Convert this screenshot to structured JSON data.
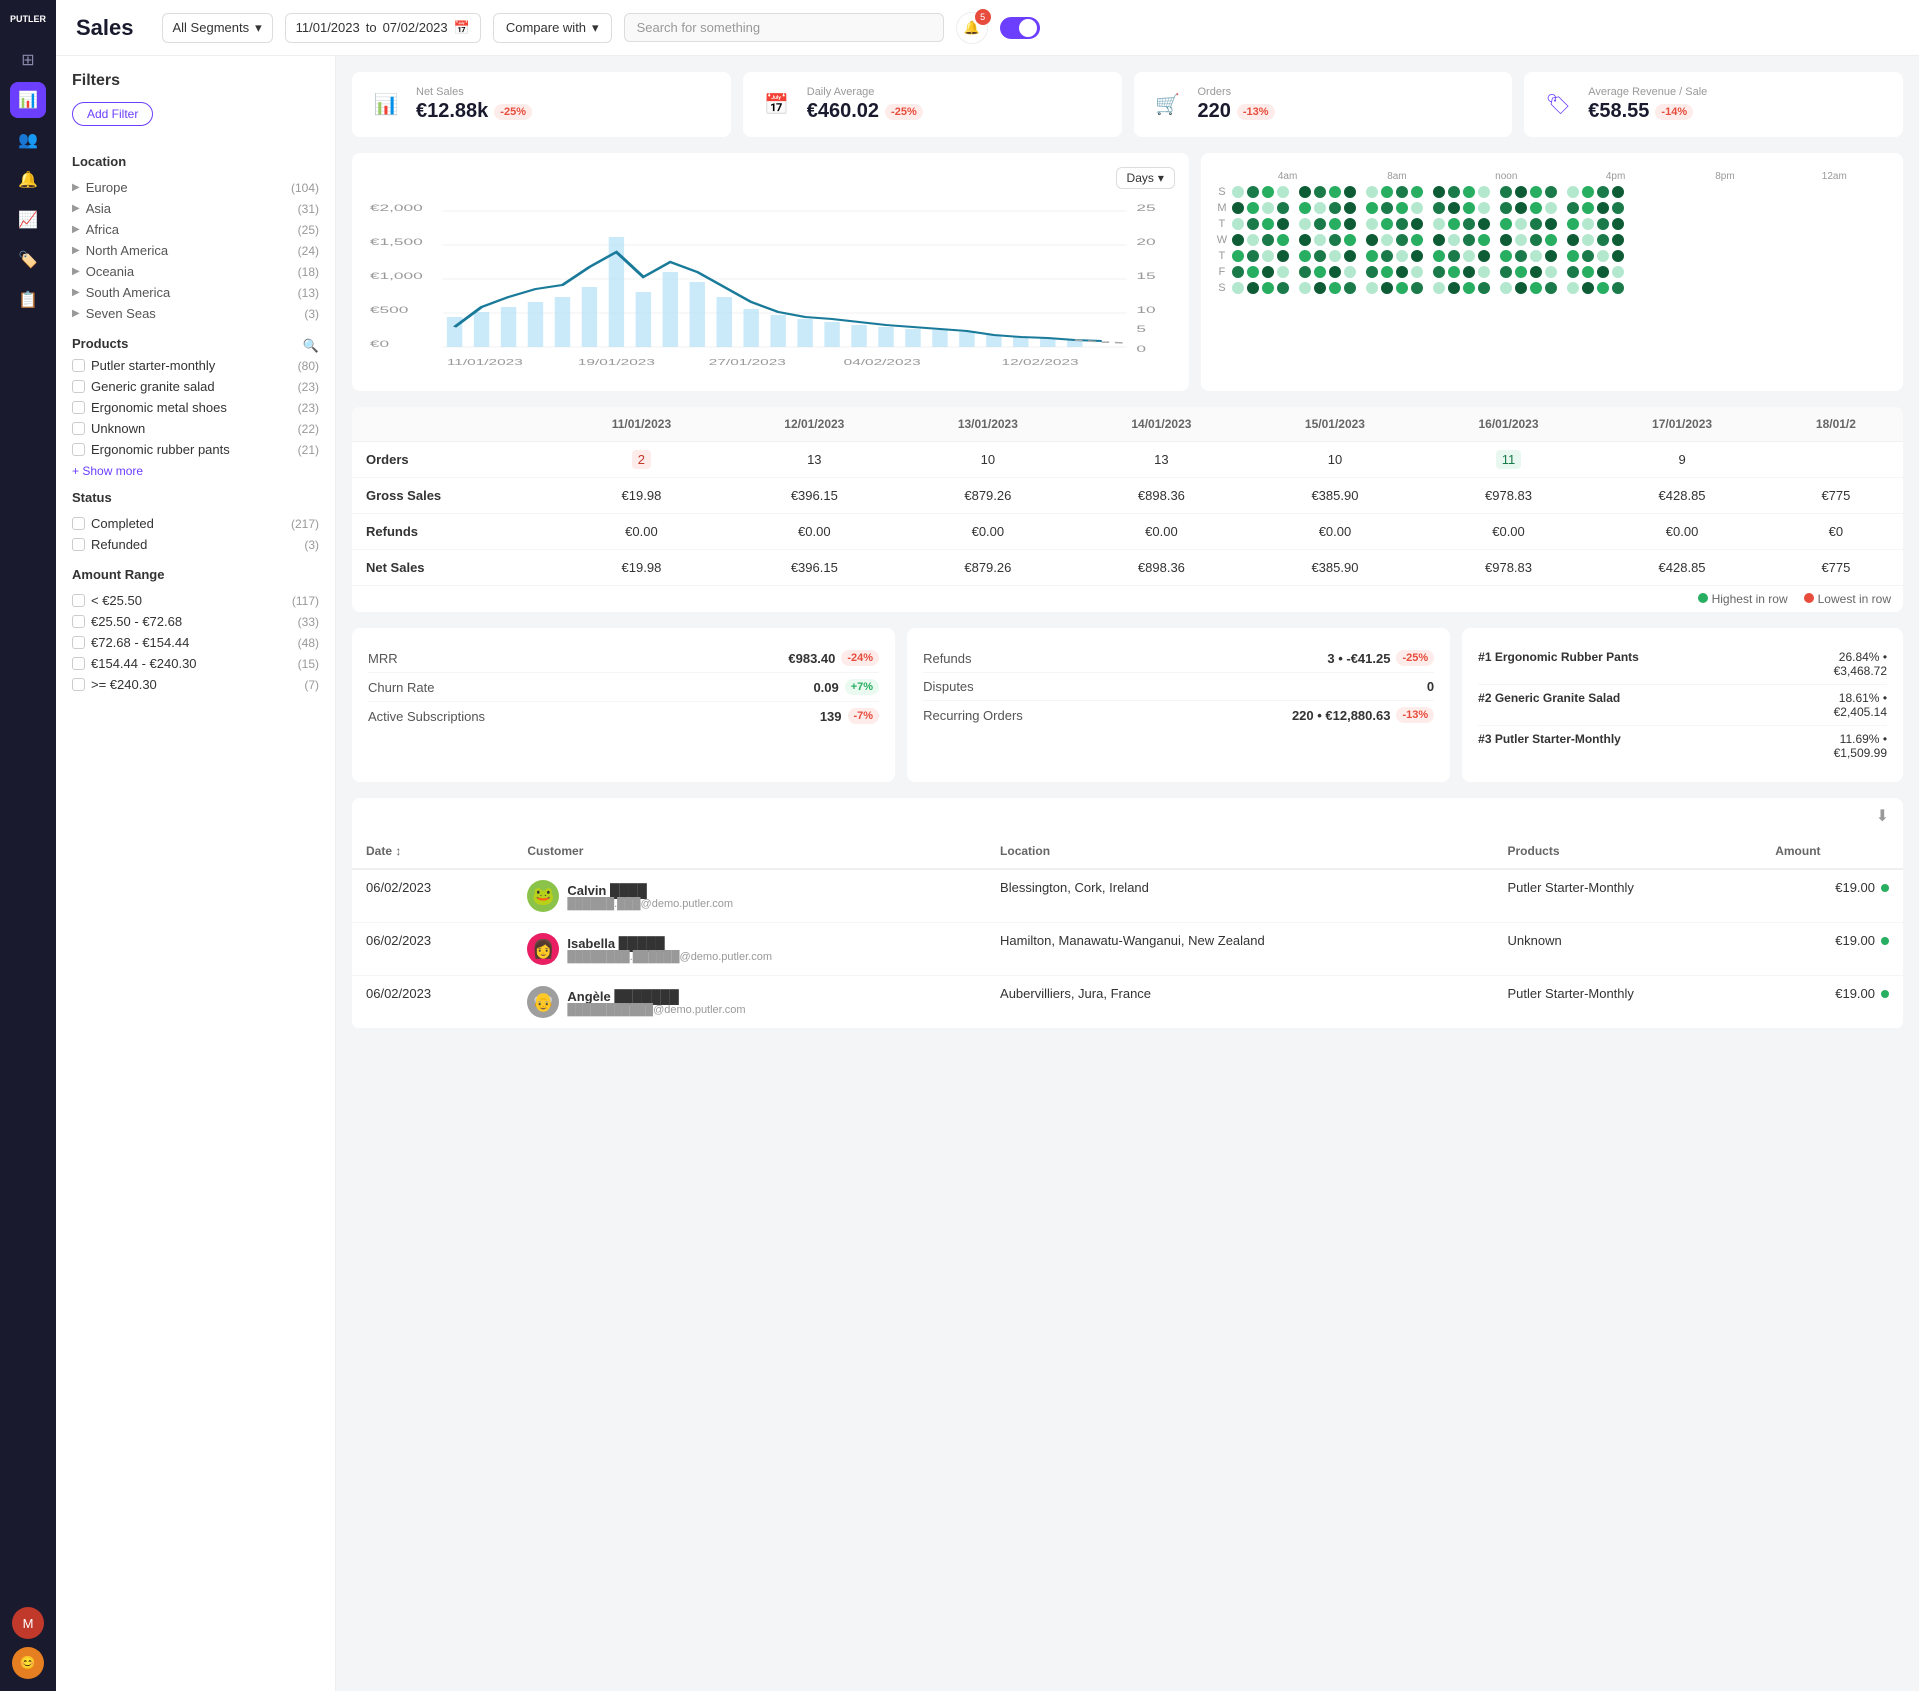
{
  "app": {
    "name": "PUTLER",
    "page_title": "Sales"
  },
  "topbar": {
    "segment": "All Segments",
    "date_from": "11/01/2023",
    "date_to": "07/02/2023",
    "compare_label": "Compare with",
    "search_placeholder": "Search for something",
    "notification_count": "5"
  },
  "kpis": [
    {
      "id": "net-sales",
      "label": "Net Sales",
      "value": "€12.88k",
      "change": "-25%",
      "change_type": "negative",
      "icon": "chart-bar"
    },
    {
      "id": "daily-avg",
      "label": "Daily Average",
      "value": "€460.02",
      "change": "-25%",
      "change_type": "negative",
      "icon": "calendar"
    },
    {
      "id": "orders",
      "label": "Orders",
      "value": "220",
      "change": "-13%",
      "change_type": "negative",
      "icon": "cart"
    },
    {
      "id": "avg-revenue",
      "label": "Average Revenue / Sale",
      "value": "€58.55",
      "change": "-14%",
      "change_type": "negative",
      "icon": "tag"
    }
  ],
  "chart": {
    "days_label": "Days",
    "x_labels": [
      "11/01/2023",
      "19/01/2023",
      "27/01/2023",
      "04/02/2023",
      "12/02/2023"
    ],
    "y_labels": [
      "€2,000",
      "€1,500",
      "€1,000",
      "€500",
      "€0"
    ],
    "y2_labels": [
      "25",
      "20",
      "15",
      "10",
      "5",
      "0"
    ]
  },
  "dot_matrix": {
    "time_labels": [
      "4am",
      "8am",
      "noon",
      "4pm",
      "8pm",
      "12am"
    ],
    "rows": [
      {
        "label": "S",
        "dots": [
          2,
          4,
          3,
          2,
          5,
          4,
          3,
          5,
          2,
          3,
          4,
          3,
          5,
          4,
          3,
          2,
          4,
          5,
          3,
          4,
          2,
          3,
          4,
          5
        ]
      },
      {
        "label": "M",
        "dots": [
          5,
          3,
          2,
          4,
          3,
          2,
          4,
          5,
          3,
          4,
          3,
          2,
          4,
          5,
          3,
          2,
          4,
          5,
          3,
          2,
          4,
          3,
          5,
          4
        ]
      },
      {
        "label": "T",
        "dots": [
          2,
          4,
          3,
          5,
          2,
          4,
          3,
          5,
          2,
          3,
          4,
          5,
          2,
          3,
          4,
          5,
          3,
          2,
          4,
          5,
          3,
          2,
          4,
          5
        ]
      },
      {
        "label": "W",
        "dots": [
          5,
          2,
          4,
          3,
          5,
          2,
          4,
          3,
          5,
          2,
          4,
          3,
          5,
          2,
          4,
          3,
          5,
          2,
          4,
          3,
          5,
          2,
          4,
          5
        ]
      },
      {
        "label": "T",
        "dots": [
          3,
          4,
          2,
          5,
          3,
          4,
          2,
          5,
          3,
          4,
          2,
          5,
          3,
          4,
          2,
          5,
          3,
          4,
          2,
          5,
          3,
          4,
          2,
          5
        ]
      },
      {
        "label": "F",
        "dots": [
          4,
          3,
          5,
          2,
          4,
          3,
          5,
          2,
          4,
          3,
          5,
          2,
          4,
          3,
          5,
          2,
          4,
          3,
          5,
          2,
          4,
          3,
          5,
          2
        ]
      },
      {
        "label": "S",
        "dots": [
          2,
          5,
          3,
          4,
          2,
          5,
          3,
          4,
          2,
          5,
          3,
          4,
          2,
          5,
          3,
          4,
          2,
          5,
          3,
          4,
          2,
          5,
          3,
          4
        ]
      }
    ]
  },
  "data_table": {
    "columns": [
      "",
      "11/01/2023",
      "12/01/2023",
      "13/01/2023",
      "14/01/2023",
      "15/01/2023",
      "16/01/2023",
      "17/01/2023",
      "18/01/2"
    ],
    "rows": [
      {
        "label": "Orders",
        "values": [
          "2",
          "13",
          "10",
          "13",
          "10",
          "11",
          "9",
          ""
        ]
      },
      {
        "label": "Gross Sales",
        "values": [
          "€19.98",
          "€396.15",
          "€879.26",
          "€898.36",
          "€385.90",
          "€978.83",
          "€428.85",
          "€775"
        ]
      },
      {
        "label": "Refunds",
        "values": [
          "€0.00",
          "€0.00",
          "€0.00",
          "€0.00",
          "€0.00",
          "€0.00",
          "€0.00",
          "€0"
        ]
      },
      {
        "label": "Net Sales",
        "values": [
          "€19.98",
          "€396.15",
          "€879.26",
          "€898.36",
          "€385.90",
          "€978.83",
          "€428.85",
          "€775"
        ]
      }
    ],
    "highlight_high": {
      "row": 0,
      "col": 5
    },
    "highlight_low": {
      "row": 0,
      "col": 0
    }
  },
  "legend": {
    "highest_label": "Highest in row",
    "lowest_label": "Lowest in row",
    "highest_color": "#27ae60",
    "lowest_color": "#e74c3c"
  },
  "metrics_left": {
    "title": "",
    "items": [
      {
        "label": "MRR",
        "value": "€983.40",
        "change": "-24%",
        "change_type": "negative"
      },
      {
        "label": "Churn Rate",
        "value": "0.09",
        "change": "+7%",
        "change_type": "positive"
      },
      {
        "label": "Active Subscriptions",
        "value": "139",
        "change": "-7%",
        "change_type": "negative"
      }
    ]
  },
  "metrics_right": {
    "items": [
      {
        "label": "Refunds",
        "value": "3",
        "extra": "• -€41.25",
        "change": "-25%",
        "change_type": "negative"
      },
      {
        "label": "Disputes",
        "value": "0",
        "extra": "",
        "change": "",
        "change_type": ""
      },
      {
        "label": "Recurring Orders",
        "value": "220",
        "extra": "• €12,880.63",
        "change": "-13%",
        "change_type": "negative"
      }
    ]
  },
  "top_products": {
    "items": [
      {
        "rank": "#1 Ergonomic Rubber Pants",
        "pct": "26.84% •",
        "amount": "€3,468.72"
      },
      {
        "rank": "#2 Generic Granite Salad",
        "pct": "18.61% •",
        "amount": "€2,405.14"
      },
      {
        "rank": "#3 Putler Starter-Monthly",
        "pct": "11.69% •",
        "amount": "€1,509.99"
      }
    ]
  },
  "orders_table": {
    "columns": [
      "Date ↕",
      "Customer",
      "Location",
      "Products",
      "Amount"
    ],
    "rows": [
      {
        "date": "06/02/2023",
        "customer_name": "Calvin ████",
        "customer_email": "██████.███@demo.putler.com",
        "avatar": "🐸",
        "avatar_bg": "#8bc34a",
        "location": "Blessington, Cork, Ireland",
        "product": "Putler Starter-Monthly",
        "amount": "€19.00",
        "dot_color": "#27ae60"
      },
      {
        "date": "06/02/2023",
        "customer_name": "Isabella █████",
        "customer_email": "████████.██████@demo.putler.com",
        "avatar": "👩",
        "avatar_bg": "#e91e63",
        "location": "Hamilton, Manawatu-Wanganui, New Zealand",
        "product": "Unknown",
        "amount": "€19.00",
        "dot_color": "#27ae60"
      },
      {
        "date": "06/02/2023",
        "customer_name": "Angèle ███████",
        "customer_email": "███████████@demo.putler.com",
        "avatar": "👴",
        "avatar_bg": "#9e9e9e",
        "location": "Aubervilliers, Jura, France",
        "product": "Putler Starter-Monthly",
        "amount": "€19.00",
        "dot_color": "#27ae60"
      }
    ]
  },
  "filters": {
    "title": "Filters",
    "add_filter_label": "Add Filter",
    "location": {
      "title": "Location",
      "items": [
        {
          "name": "Europe",
          "count": "(104)"
        },
        {
          "name": "Asia",
          "count": "(31)"
        },
        {
          "name": "Africa",
          "count": "(25)"
        },
        {
          "name": "North America",
          "count": "(24)"
        },
        {
          "name": "Oceania",
          "count": "(18)"
        },
        {
          "name": "South America",
          "count": "(13)"
        },
        {
          "name": "Seven Seas",
          "count": "(3)"
        }
      ]
    },
    "products": {
      "title": "Products",
      "items": [
        {
          "name": "Putler starter-monthly",
          "count": "(80)"
        },
        {
          "name": "Generic granite salad",
          "count": "(23)"
        },
        {
          "name": "Ergonomic metal shoes",
          "count": "(23)"
        },
        {
          "name": "Unknown",
          "count": "(22)"
        },
        {
          "name": "Ergonomic rubber pants",
          "count": "(21)"
        }
      ],
      "show_more": "+ Show more"
    },
    "status": {
      "title": "Status",
      "items": [
        {
          "name": "Completed",
          "count": "(217)"
        },
        {
          "name": "Refunded",
          "count": "(3)"
        }
      ]
    },
    "amount_range": {
      "title": "Amount Range",
      "items": [
        {
          "name": "< €25.50",
          "count": "(117)"
        },
        {
          "name": "€25.50 - €72.68",
          "count": "(33)"
        },
        {
          "name": "€72.68 - €154.44",
          "count": "(48)"
        },
        {
          "name": "€154.44 - €240.30",
          "count": "(15)"
        },
        {
          "name": ">= €240.30",
          "count": "(7)"
        }
      ]
    }
  },
  "sidebar": {
    "icons": [
      "⊞",
      "📊",
      "👥",
      "🔔",
      "📈",
      "🏷️",
      "👤"
    ],
    "active_index": 1
  }
}
